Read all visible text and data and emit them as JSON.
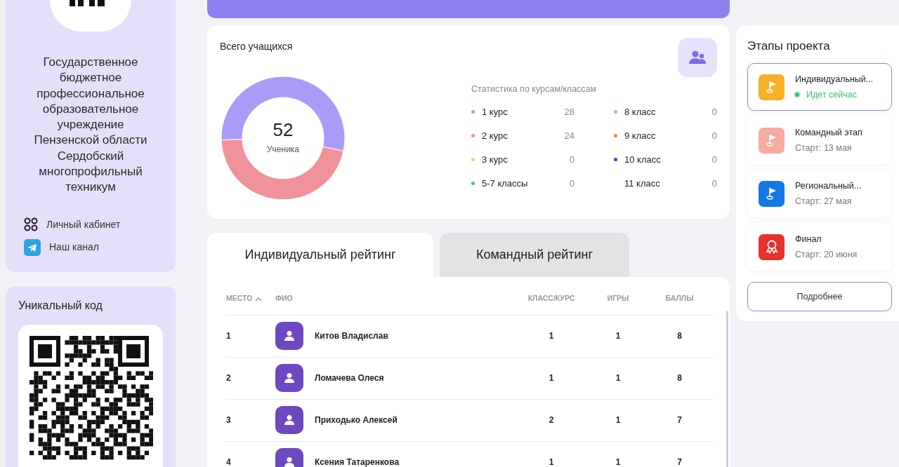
{
  "organization": {
    "name": "Государственное бюджетное профессиональное образовательное учреждение Пензенской области Сердобский многопрофильный техникум"
  },
  "sidebar": {
    "links": [
      {
        "label": "Личный кабинет",
        "kind": "grid"
      },
      {
        "label": "Наш канал",
        "kind": "telegram"
      }
    ]
  },
  "unique_code": {
    "title": "Уникальный код"
  },
  "students": {
    "title": "Всего учащихся",
    "center_value": "52",
    "center_label": "Ученика",
    "chart_data": {
      "type": "donut",
      "values": [
        53.85,
        46.15
      ],
      "colors": [
        "#a99cf7",
        "#f0929a"
      ]
    },
    "stats_title": "Статистика по курсам/классам",
    "stats": [
      {
        "label": "1 курс",
        "count": "28",
        "color": "#a99cf7"
      },
      {
        "label": "8 класс",
        "count": "0",
        "color": "#7cc8ef"
      },
      {
        "label": "2 курс",
        "count": "24",
        "color": "#f0929a"
      },
      {
        "label": "9 класс",
        "count": "0",
        "color": "#f08a2c"
      },
      {
        "label": "3 курс",
        "count": "0",
        "color": "#f7d061"
      },
      {
        "label": "10 класс",
        "count": "0",
        "color": "#2a4fd4"
      },
      {
        "label": "5-7 классы",
        "count": "0",
        "color": "#3cc98a"
      },
      {
        "label": "11 класс",
        "count": "0"
      }
    ]
  },
  "rating_tabs": [
    {
      "label": "Индивидуальный рейтинг",
      "selected": true
    },
    {
      "label": "Командный рейтинг",
      "selected": false
    }
  ],
  "table": {
    "columns": [
      {
        "label": "МЕСТО",
        "sort_ascending": true
      },
      {
        "label": "ФИО"
      },
      {
        "label": "КЛАСС/КУРС"
      },
      {
        "label": "ИГРЫ"
      },
      {
        "label": "БАЛЛЫ"
      }
    ],
    "rows": [
      [
        "1",
        "Китов Владислав",
        "1",
        "1",
        "8"
      ],
      [
        "2",
        "Ломачева Олеся",
        "1",
        "1",
        "8"
      ],
      [
        "3",
        "Приходько Алексей",
        "2",
        "1",
        "7"
      ],
      [
        "4",
        "Ксения Татаренкова",
        "1",
        "1",
        "7"
      ]
    ]
  },
  "stages": {
    "title": "Этапы проекта",
    "items": [
      {
        "title": "Индивидуальный...",
        "subtitle": "Идет сейчас",
        "selected": true,
        "kind": "flag",
        "color": "#f7b125"
      },
      {
        "title": "Командный этап",
        "subtitle": "Старт: 13 мая",
        "selected": false,
        "kind": "flag",
        "color": "#f5ada0"
      },
      {
        "title": "Региональный...",
        "subtitle": "Старт: 27 мая",
        "selected": false,
        "kind": "flag",
        "color": "#1479e6"
      },
      {
        "title": "Финал",
        "subtitle": "Старт: 20 июня",
        "selected": false,
        "kind": "medal",
        "color": "#e5322a"
      }
    ],
    "button": "Подробнее"
  }
}
